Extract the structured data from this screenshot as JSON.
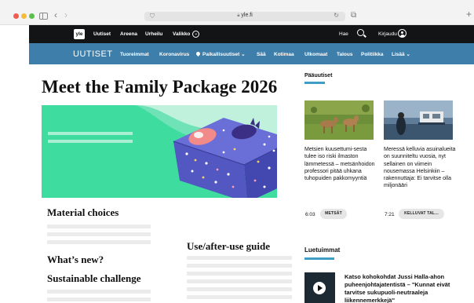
{
  "browser": {
    "url": "yle.fi"
  },
  "topnav": {
    "logo": "yle",
    "items": [
      "Uutiset",
      "Areena",
      "Urheilu",
      "Valikko"
    ],
    "search_label": "Hae",
    "login_label": "Kirjaudu"
  },
  "subnav": {
    "brand": "UUTISET",
    "items": [
      "Tuoreimmat",
      "Koronavirus",
      "Paikallisuutiset",
      "Sää",
      "Kotimaa",
      "Ulkomaat",
      "Talous",
      "Politiikka",
      "Lisää"
    ]
  },
  "article": {
    "headline": "Meet the Family Package 2026",
    "sections": {
      "material": "Material choices",
      "whats_new": "What’s new?",
      "sustainable": "Sustainable challenge",
      "guide": "Use/after-use guide"
    }
  },
  "paauutiset": {
    "heading": "Pääuutiset",
    "stories": [
      {
        "text": "Metsien kuusettumi-sesta tulee iso riski ilmaston lämmetessä – metsänhoidon professori pitää uhkana tuhopuiden pakkomyyntiä",
        "time": "6:03",
        "tag": "METSÄT"
      },
      {
        "text": "Meressä kelluvia asuinalueita on suunniteltu vuosia, nyt sellainen on viimein nousemassa Helsinkiin – rakennuttaja: Ei tarvitse olla miljonääri",
        "time": "7:21",
        "tag": "KELLUVAT TAL..."
      }
    ]
  },
  "luetuimmat": {
    "heading": "Luetuimmat",
    "item": "Katso kohokohdat Jussi Halla-ahon puheenjohtajatentistä – \"Kunnat eivät tarvitse sukupuoli-neutraaleja liikennemerkkejä\""
  },
  "colors": {
    "topnav": "#131415",
    "subnav": "#3e7eaa",
    "accent": "#3e9ec4",
    "hero_green": "#3fdca0",
    "box_blue": "#6a6fd8"
  }
}
